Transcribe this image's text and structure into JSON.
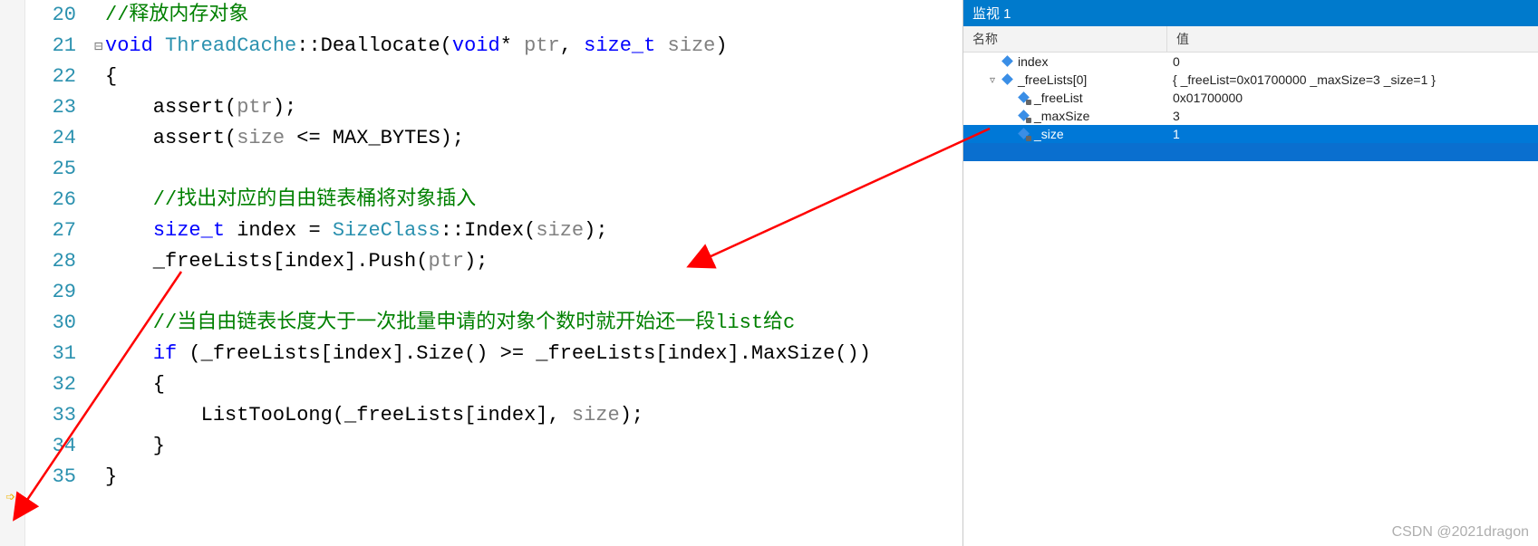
{
  "editor": {
    "lines": [
      {
        "n": 20,
        "tokens": [
          {
            "t": "//释放内存对象",
            "c": "comment"
          }
        ]
      },
      {
        "n": 21,
        "tokens": [
          {
            "t": "void ",
            "c": "type"
          },
          {
            "t": "ThreadCache",
            "c": "cls"
          },
          {
            "t": "::Deallocate(",
            "c": "op"
          },
          {
            "t": "void",
            "c": "type"
          },
          {
            "t": "* ",
            "c": "op"
          },
          {
            "t": "ptr",
            "c": "param"
          },
          {
            "t": ", ",
            "c": "op"
          },
          {
            "t": "size_t ",
            "c": "type"
          },
          {
            "t": "size",
            "c": "param"
          },
          {
            "t": ")",
            "c": "op"
          }
        ],
        "outline": true
      },
      {
        "n": 22,
        "tokens": [
          {
            "t": "{",
            "c": "op"
          }
        ]
      },
      {
        "n": 23,
        "tokens": [
          {
            "t": "    assert(",
            "c": "func"
          },
          {
            "t": "ptr",
            "c": "param"
          },
          {
            "t": ");",
            "c": "op"
          }
        ]
      },
      {
        "n": 24,
        "tokens": [
          {
            "t": "    assert(",
            "c": "func"
          },
          {
            "t": "size",
            "c": "param"
          },
          {
            "t": " <= MAX_BYTES);",
            "c": "op"
          }
        ]
      },
      {
        "n": 25,
        "tokens": [
          {
            "t": "",
            "c": "op"
          }
        ]
      },
      {
        "n": 26,
        "tokens": [
          {
            "t": "    //找出对应的自由链表桶将对象插入",
            "c": "comment"
          }
        ]
      },
      {
        "n": 27,
        "tokens": [
          {
            "t": "    ",
            "c": "op"
          },
          {
            "t": "size_t",
            "c": "type"
          },
          {
            "t": " index = ",
            "c": "op"
          },
          {
            "t": "SizeClass",
            "c": "cls"
          },
          {
            "t": "::Index(",
            "c": "op"
          },
          {
            "t": "size",
            "c": "param"
          },
          {
            "t": ");",
            "c": "op"
          }
        ]
      },
      {
        "n": 28,
        "tokens": [
          {
            "t": "    _freeLists[index].Push(",
            "c": "func"
          },
          {
            "t": "ptr",
            "c": "param"
          },
          {
            "t": ");",
            "c": "op"
          }
        ]
      },
      {
        "n": 29,
        "tokens": [
          {
            "t": "",
            "c": "op"
          }
        ]
      },
      {
        "n": 30,
        "tokens": [
          {
            "t": "    //当自由链表长度大于一次批量申请的对象个数时就开始还一段list给c",
            "c": "comment"
          }
        ]
      },
      {
        "n": 31,
        "tokens": [
          {
            "t": "    ",
            "c": "op"
          },
          {
            "t": "if",
            "c": "keyword"
          },
          {
            "t": " (_freeLists[index].Size() >= _freeLists[index].MaxSize())",
            "c": "op"
          }
        ]
      },
      {
        "n": 32,
        "tokens": [
          {
            "t": "    {",
            "c": "op"
          }
        ]
      },
      {
        "n": 33,
        "tokens": [
          {
            "t": "        ListTooLong(_freeLists[index], ",
            "c": "func"
          },
          {
            "t": "size",
            "c": "param"
          },
          {
            "t": ");",
            "c": "op"
          }
        ]
      },
      {
        "n": 34,
        "tokens": [
          {
            "t": "    }",
            "c": "op"
          }
        ]
      },
      {
        "n": 35,
        "tokens": [
          {
            "t": "}",
            "c": "op"
          }
        ]
      }
    ]
  },
  "watch": {
    "title": "监视 1",
    "columns": {
      "name": "名称",
      "value": "值"
    },
    "rows": [
      {
        "depth": 0,
        "expander": "",
        "icon": "cube",
        "name": "index",
        "value": "0",
        "selected": false
      },
      {
        "depth": 0,
        "expander": "▿",
        "icon": "cube",
        "name": "_freeLists[0]",
        "value": "{ _freeList=0x01700000 _maxSize=3 _size=1 }",
        "selected": false
      },
      {
        "depth": 1,
        "expander": "",
        "icon": "cube locked",
        "name": "_freeList",
        "value": "0x01700000",
        "selected": false
      },
      {
        "depth": 1,
        "expander": "",
        "icon": "cube locked",
        "name": "_maxSize",
        "value": "3",
        "selected": false
      },
      {
        "depth": 1,
        "expander": "",
        "icon": "cube locked",
        "name": "_size",
        "value": "1",
        "selected": true
      }
    ]
  },
  "watermark": "CSDN @2021dragon"
}
